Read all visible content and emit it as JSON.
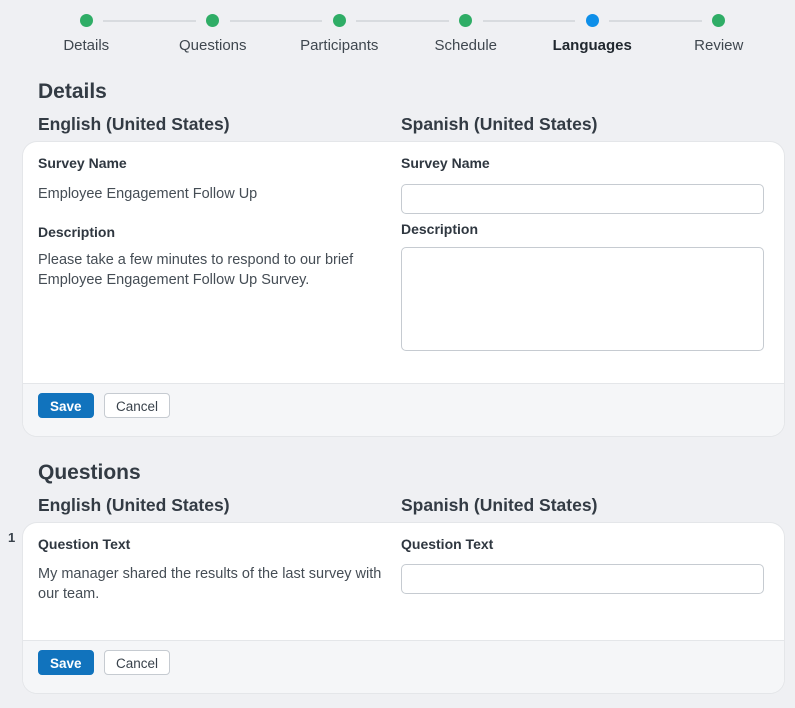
{
  "colors": {
    "dot_complete": "#2fad66",
    "dot_current": "#0e8fe9",
    "accent": "#1173bd"
  },
  "stepper": {
    "steps": [
      {
        "label": "Details",
        "state": "complete"
      },
      {
        "label": "Questions",
        "state": "complete"
      },
      {
        "label": "Participants",
        "state": "complete"
      },
      {
        "label": "Schedule",
        "state": "complete"
      },
      {
        "label": "Languages",
        "state": "current"
      },
      {
        "label": "Review",
        "state": "complete"
      }
    ]
  },
  "details_section": {
    "title": "Details",
    "source_language": "English (United States)",
    "target_language": "Spanish (United States)",
    "fields": {
      "survey_name_label": "Survey Name",
      "survey_name_value": "Employee Engagement Follow Up",
      "description_label": "Description",
      "description_value": "Please take a few minutes to respond to our brief Employee Engagement Follow Up Survey.",
      "survey_name_translation": "",
      "description_translation": ""
    },
    "actions": {
      "save": "Save",
      "cancel": "Cancel"
    }
  },
  "questions_section": {
    "title": "Questions",
    "source_language": "English (United States)",
    "target_language": "Spanish (United States)",
    "questions": [
      {
        "number": "1",
        "label": "Question Text",
        "text": "My manager shared the results of the last survey with our team.",
        "translation": ""
      }
    ],
    "actions": {
      "save": "Save",
      "cancel": "Cancel"
    }
  }
}
